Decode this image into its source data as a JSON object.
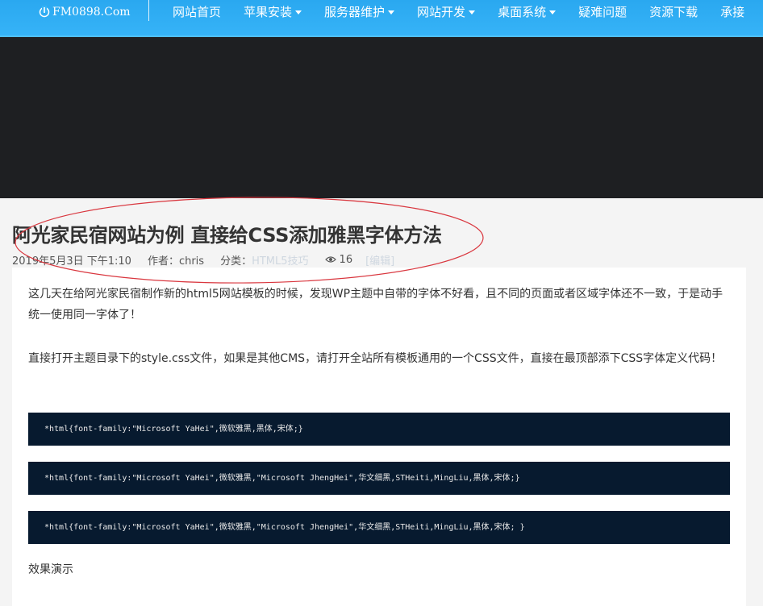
{
  "nav": {
    "logo_text": "FM0898.Com",
    "items": [
      {
        "label": "网站首页",
        "dropdown": false
      },
      {
        "label": "苹果安装",
        "dropdown": true
      },
      {
        "label": "服务器维护",
        "dropdown": true
      },
      {
        "label": "网站开发",
        "dropdown": true
      },
      {
        "label": "桌面系统",
        "dropdown": true
      },
      {
        "label": "疑难问题",
        "dropdown": false
      },
      {
        "label": "资源下载",
        "dropdown": false
      },
      {
        "label": "承接",
        "dropdown": false
      }
    ]
  },
  "post": {
    "title": "阿光家民宿网站为例 直接给CSS添加雅黑字体方法",
    "date": "2019年5月3日 下午1:10",
    "author": "作者：chris",
    "category_label": "分类：",
    "category": "HTML5技巧",
    "views": "16",
    "edit": "[编辑]"
  },
  "article": {
    "p1": "这几天在给阿光家民宿制作新的html5网站模板的时候，发现WP主题中自带的字体不好看，且不同的页面或者区域字体还不一致，于是动手统一使用同一字体了！",
    "p2": "直接打开主题目录下的style.css文件，如果是其他CMS，请打开全站所有模板通用的一个CSS文件，直接在最顶部添下CSS字体定义代码！",
    "code1": "*html{font-family:\"Microsoft YaHei\",微软雅黑,黑体,宋体;}",
    "code2": "*html{font-family:\"Microsoft YaHei\",微软雅黑,\"Microsoft JhengHei\",华文细黑,STHeiti,MingLiu,黑体,宋体;}",
    "code3": "*html{font-family:\"Microsoft YaHei\",微软雅黑,\"Microsoft JhengHei\",华文细黑,STHeiti,MingLiu,黑体,宋体; }",
    "p3": "效果演示"
  },
  "colors": {
    "nav_bg": "#36b3f7",
    "hero_bg": "#1e1f22",
    "code_bg": "#071a2f",
    "annotation": "#d9363e"
  }
}
